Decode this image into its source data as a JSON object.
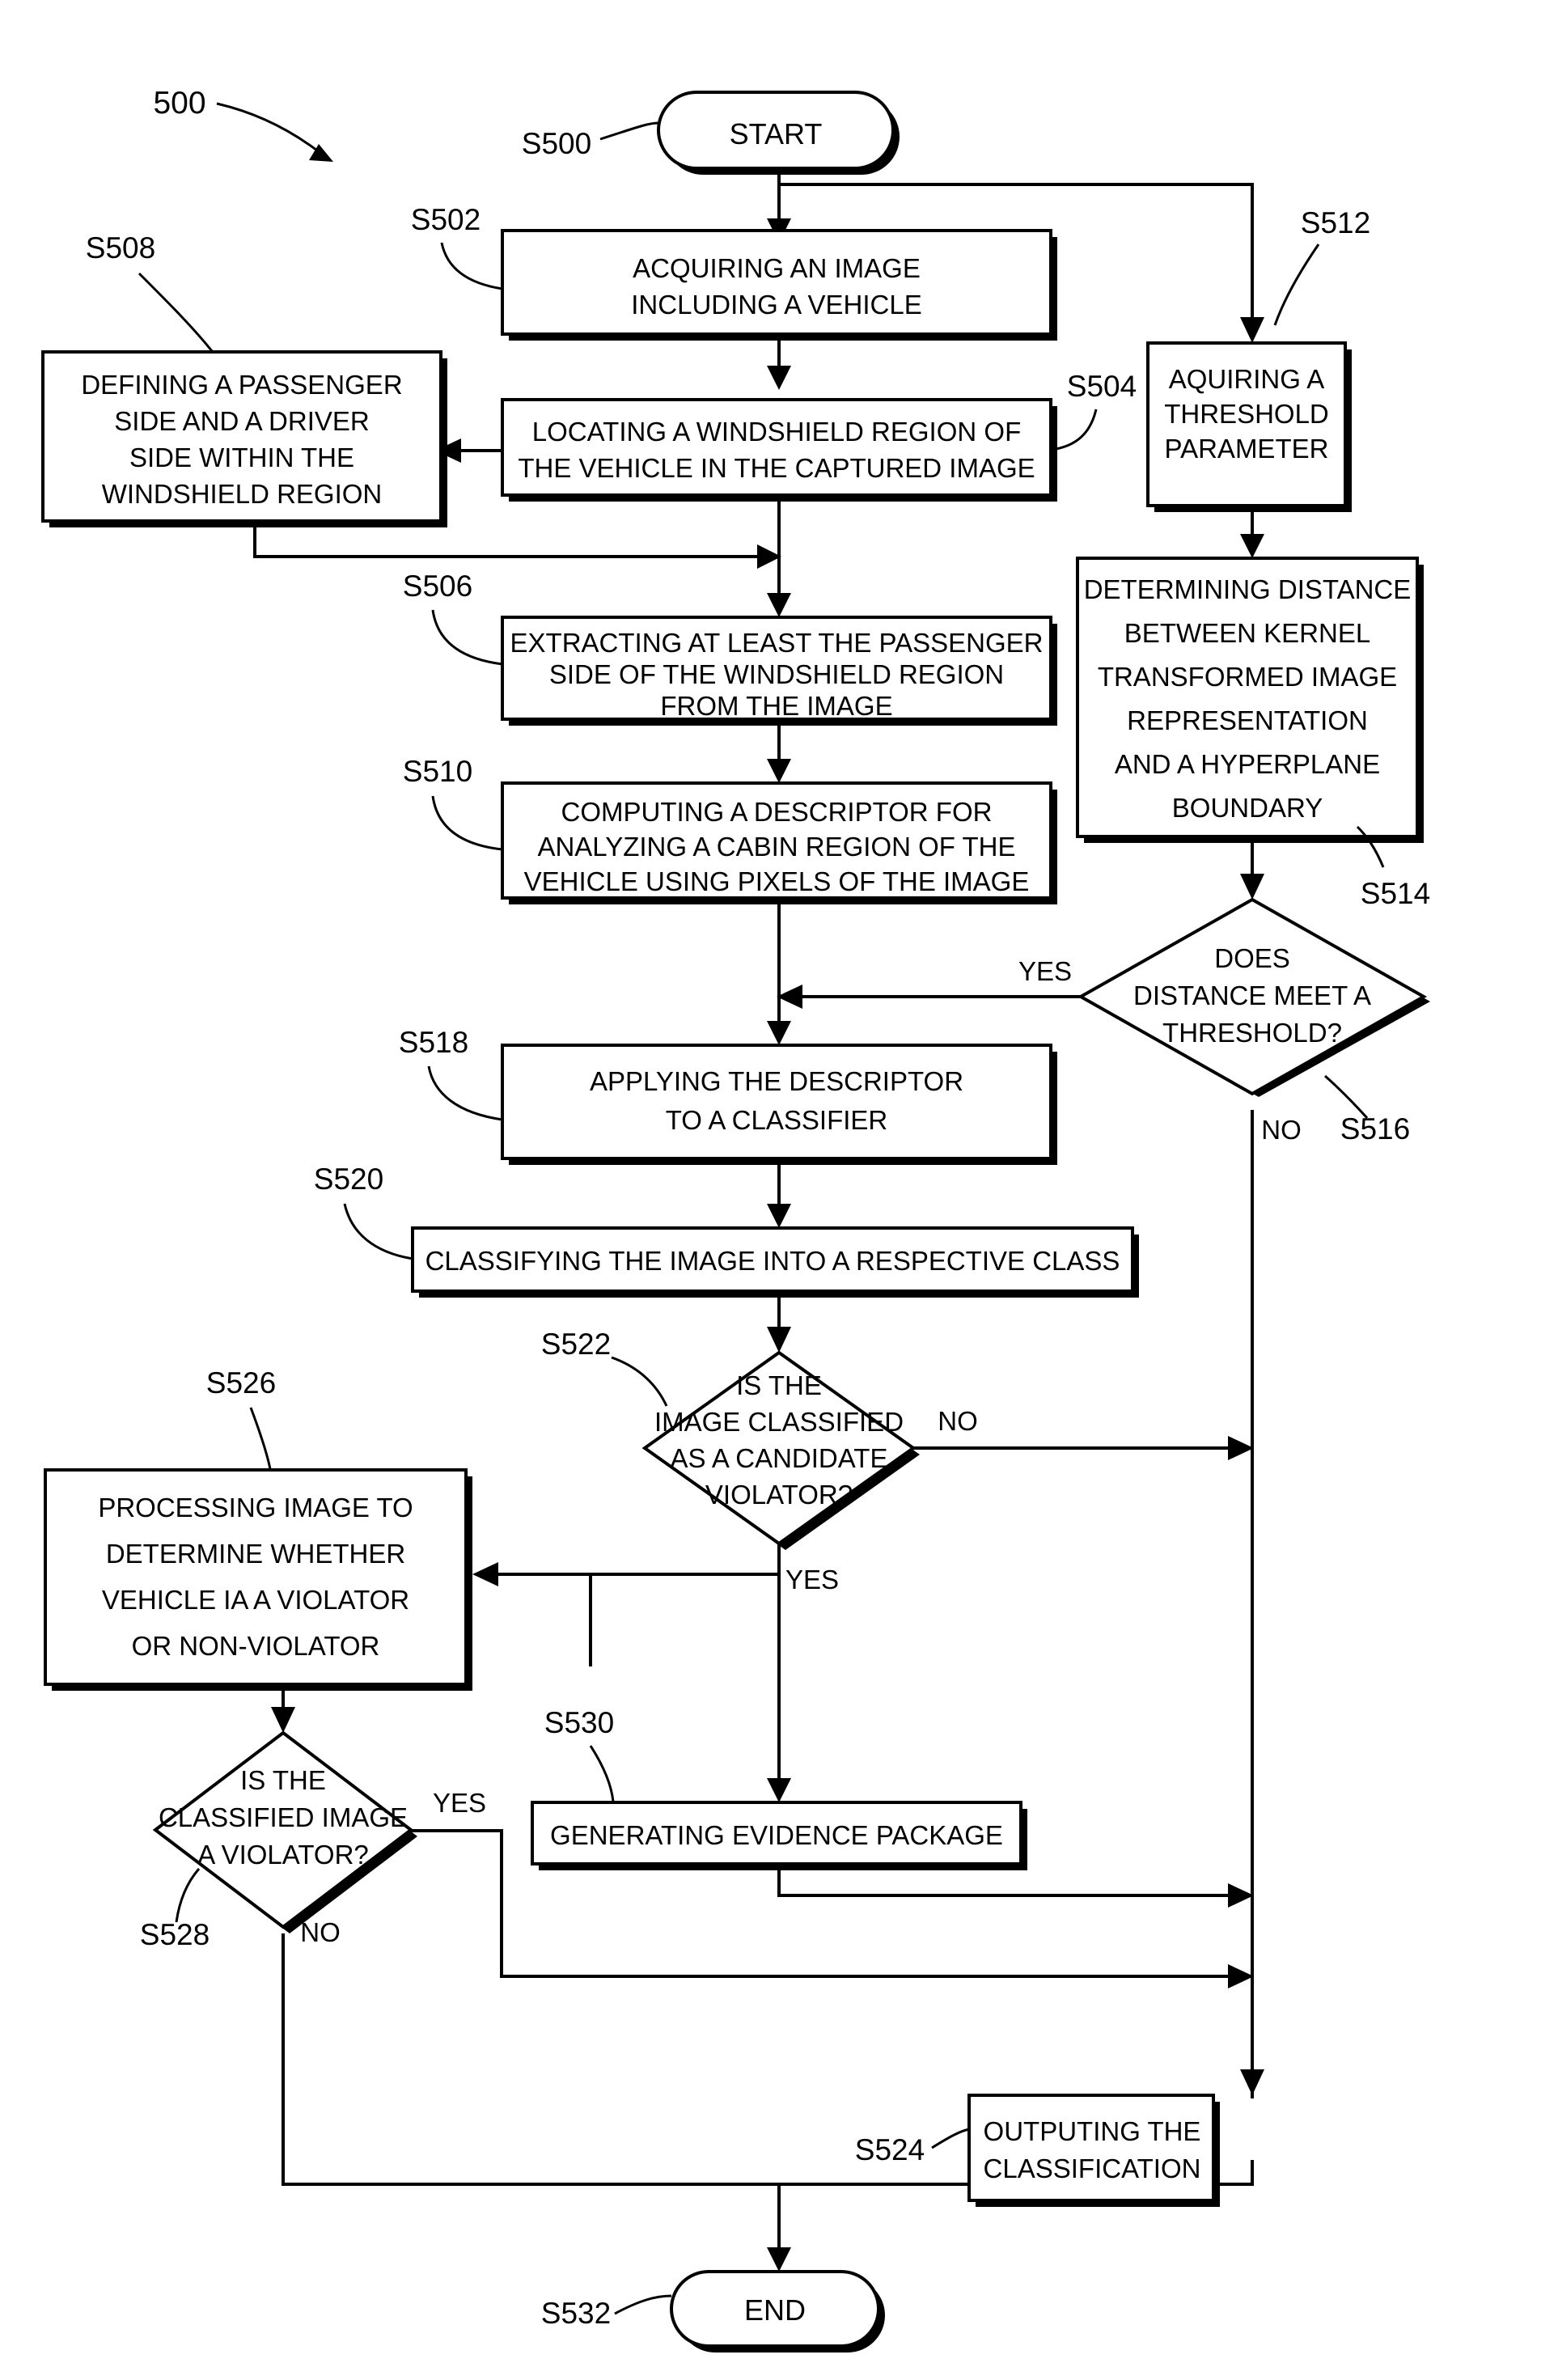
{
  "figure": {
    "number": "500"
  },
  "terminals": {
    "start": {
      "label": "START",
      "ref": "S500"
    },
    "end": {
      "label": "END",
      "ref": "S532"
    }
  },
  "nodes": [
    {
      "id": "s502",
      "ref": "S502",
      "shape": "process",
      "lines": [
        "ACQUIRING AN IMAGE",
        "INCLUDING A VEHICLE"
      ]
    },
    {
      "id": "s504",
      "ref": "S504",
      "shape": "process",
      "lines": [
        "LOCATING A WINDSHIELD REGION OF",
        "THE VEHICLE IN THE CAPTURED IMAGE"
      ]
    },
    {
      "id": "s508",
      "ref": "S508",
      "shape": "process",
      "lines": [
        "DEFINING A PASSENGER",
        "SIDE AND A DRIVER",
        "SIDE WITHIN THE",
        "WINDSHIELD REGION"
      ]
    },
    {
      "id": "s506",
      "ref": "S506",
      "shape": "process",
      "lines": [
        "EXTRACTING AT LEAST THE PASSENGER",
        "SIDE OF THE WINDSHIELD REGION",
        "FROM THE IMAGE"
      ]
    },
    {
      "id": "s510",
      "ref": "S510",
      "shape": "process",
      "lines": [
        "COMPUTING A DESCRIPTOR FOR",
        "ANALYZING A CABIN REGION OF THE",
        "VEHICLE USING PIXELS OF THE IMAGE"
      ]
    },
    {
      "id": "s512",
      "ref": "S512",
      "shape": "process",
      "lines": [
        "AQUIRING A",
        "THRESHOLD",
        "PARAMETER"
      ]
    },
    {
      "id": "s513",
      "ref": "",
      "shape": "process",
      "lines": [
        "DETERMINING DISTANCE",
        "BETWEEN KERNEL",
        "TRANSFORMED IMAGE",
        "REPRESENTATION",
        "AND A HYPERPLANE",
        "BOUNDARY"
      ]
    },
    {
      "id": "s514",
      "ref": "S514",
      "ref2": "S516",
      "shape": "decision",
      "lines": [
        "DOES",
        "DISTANCE MEET A",
        "THRESHOLD?"
      ],
      "yes_label": "YES",
      "no_label": "NO"
    },
    {
      "id": "s518",
      "ref": "S518",
      "shape": "process",
      "lines": [
        "APPLYING THE DESCRIPTOR",
        "TO A CLASSIFIER"
      ]
    },
    {
      "id": "s520",
      "ref": "S520",
      "shape": "process",
      "lines": [
        "CLASSIFYING THE IMAGE INTO A RESPECTIVE CLASS"
      ]
    },
    {
      "id": "s522",
      "ref": "S522",
      "shape": "decision",
      "lines": [
        "IS THE",
        "IMAGE CLASSIFIED",
        "AS A CANDIDATE",
        "VIOLATOR?"
      ],
      "yes_label": "YES",
      "no_label": "NO"
    },
    {
      "id": "s526",
      "ref": "S526",
      "shape": "process",
      "lines": [
        "PROCESSING IMAGE TO",
        "DETERMINE WHETHER",
        "VEHICLE IA A VIOLATOR",
        "OR NON-VIOLATOR"
      ]
    },
    {
      "id": "s528",
      "ref": "S528",
      "shape": "decision",
      "lines": [
        "IS THE",
        "CLASSIFIED IMAGE",
        "A VIOLATOR?"
      ],
      "yes_label": "YES",
      "no_label": "NO"
    },
    {
      "id": "s530",
      "ref": "S530",
      "shape": "process",
      "lines": [
        "GENERATING EVIDENCE PACKAGE"
      ]
    },
    {
      "id": "s524",
      "ref": "S524",
      "shape": "process",
      "lines": [
        "OUTPUTING THE",
        "CLASSIFICATION"
      ]
    }
  ],
  "text": {
    "fig_num": "500",
    "start": "START",
    "end": "END",
    "ref_s500": "S500",
    "ref_s502": "S502",
    "ref_s504": "S504",
    "ref_s506": "S506",
    "ref_s508": "S508",
    "ref_s510": "S510",
    "ref_s512": "S512",
    "ref_s514": "S514",
    "ref_s516": "S516",
    "ref_s518": "S518",
    "ref_s520": "S520",
    "ref_s522": "S522",
    "ref_s524": "S524",
    "ref_s526": "S526",
    "ref_s528": "S528",
    "ref_s530": "S530",
    "ref_s532": "S532",
    "s502_l1": "ACQUIRING AN IMAGE",
    "s502_l2": "INCLUDING A VEHICLE",
    "s504_l1": "LOCATING A WINDSHIELD REGION OF",
    "s504_l2": "THE VEHICLE IN THE CAPTURED IMAGE",
    "s508_l1": "DEFINING A PASSENGER",
    "s508_l2": "SIDE AND A DRIVER",
    "s508_l3": "SIDE WITHIN THE",
    "s508_l4": "WINDSHIELD REGION",
    "s506_l1": "EXTRACTING AT LEAST THE PASSENGER",
    "s506_l2": "SIDE OF THE WINDSHIELD REGION",
    "s506_l3": "FROM THE IMAGE",
    "s510_l1": "COMPUTING A DESCRIPTOR FOR",
    "s510_l2": "ANALYZING A CABIN REGION OF THE",
    "s510_l3": "VEHICLE USING PIXELS OF THE IMAGE",
    "s512_l1": "AQUIRING A",
    "s512_l2": "THRESHOLD",
    "s512_l3": "PARAMETER",
    "s513_l1": "DETERMINING DISTANCE",
    "s513_l2": "BETWEEN KERNEL",
    "s513_l3": "TRANSFORMED IMAGE",
    "s513_l4": "REPRESENTATION",
    "s513_l5": "AND A HYPERPLANE",
    "s513_l6": "BOUNDARY",
    "s514_l1": "DOES",
    "s514_l2": "DISTANCE MEET A",
    "s514_l3": "THRESHOLD?",
    "s514_yes": "YES",
    "s514_no": "NO",
    "s518_l1": "APPLYING THE DESCRIPTOR",
    "s518_l2": "TO A CLASSIFIER",
    "s520_l1": "CLASSIFYING THE IMAGE INTO A RESPECTIVE CLASS",
    "s522_l1": "IS THE",
    "s522_l2": "IMAGE CLASSIFIED",
    "s522_l3": "AS A CANDIDATE",
    "s522_l4": "VIOLATOR?",
    "s522_yes": "YES",
    "s522_no": "NO",
    "s526_l1": "PROCESSING IMAGE TO",
    "s526_l2": "DETERMINE WHETHER",
    "s526_l3": "VEHICLE IA A VIOLATOR",
    "s526_l4": "OR NON-VIOLATOR",
    "s528_l1": "IS THE",
    "s528_l2": "CLASSIFIED IMAGE",
    "s528_l3": "A VIOLATOR?",
    "s528_yes": "YES",
    "s528_no": "NO",
    "s530_l1": "GENERATING EVIDENCE PACKAGE",
    "s524_l1": "OUTPUTING THE",
    "s524_l2": "CLASSIFICATION"
  },
  "colors": {
    "stroke": "#000000",
    "fill": "#ffffff"
  }
}
